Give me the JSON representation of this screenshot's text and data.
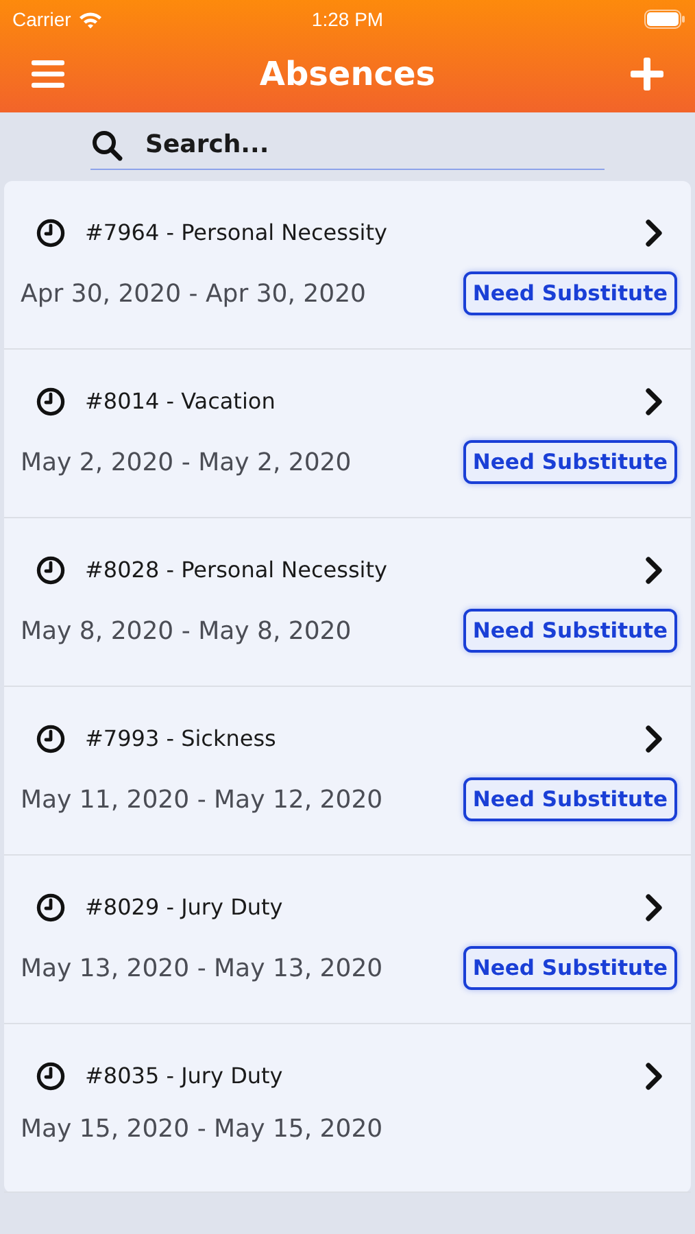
{
  "status_bar": {
    "carrier": "Carrier",
    "time": "1:28 PM"
  },
  "nav": {
    "title": "Absences"
  },
  "search": {
    "placeholder": "Search..."
  },
  "absences": [
    {
      "title": "#7964 - Personal Necessity",
      "dates": "Apr 30, 2020 - Apr 30, 2020",
      "badge": "Need Substitute"
    },
    {
      "title": "#8014 - Vacation",
      "dates": "May 2, 2020 - May 2, 2020",
      "badge": "Need Substitute"
    },
    {
      "title": "#8028 - Personal Necessity",
      "dates": "May 8, 2020 - May 8, 2020",
      "badge": "Need Substitute"
    },
    {
      "title": "#7993 - Sickness",
      "dates": "May 11, 2020 - May 12, 2020",
      "badge": "Need Substitute"
    },
    {
      "title": "#8029 - Jury Duty",
      "dates": "May 13, 2020 - May 13, 2020",
      "badge": "Need Substitute"
    },
    {
      "title": "#8035 - Jury Duty",
      "dates": "May 15, 2020 - May 15, 2020"
    }
  ]
}
